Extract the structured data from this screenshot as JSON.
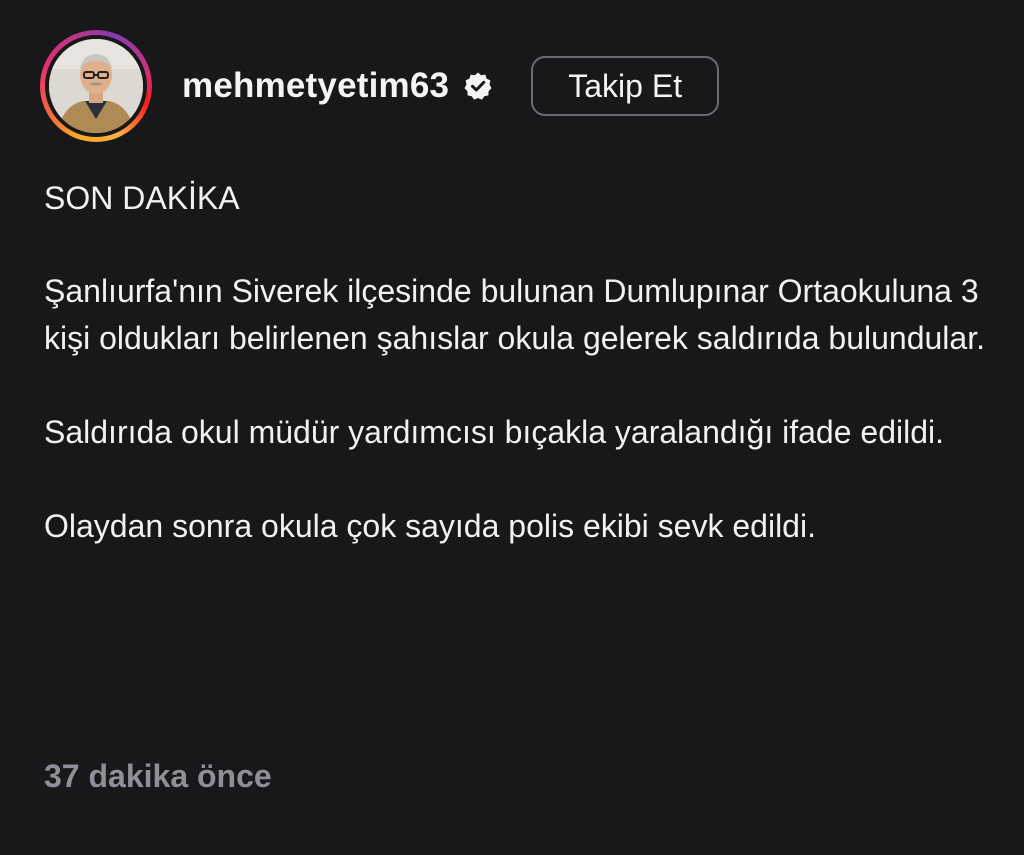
{
  "post": {
    "author": {
      "username": "mehmetyetim63",
      "verified": true,
      "avatar_icon": "profile-photo"
    },
    "follow_label": "Takip Et",
    "headline": "SON DAKİKA",
    "paragraphs": [
      "Şanlıurfa'nın Siverek ilçesinde bulunan Dumlupınar Ortaokuluna 3 kişi oldukları belirlenen şahıslar okula gelerek saldırıda bulundular.",
      "Saldırıda okul müdür yardımcısı bıçakla yaralandığı ifade edildi.",
      "Olaydan sonra okula çok sayıda polis ekibi sevk edildi."
    ],
    "timestamp": "37 dakika önce"
  },
  "colors": {
    "background": "#18181a",
    "text": "#f1f1f1",
    "muted": "#8e8f98",
    "button_border": "#6b6b70"
  }
}
